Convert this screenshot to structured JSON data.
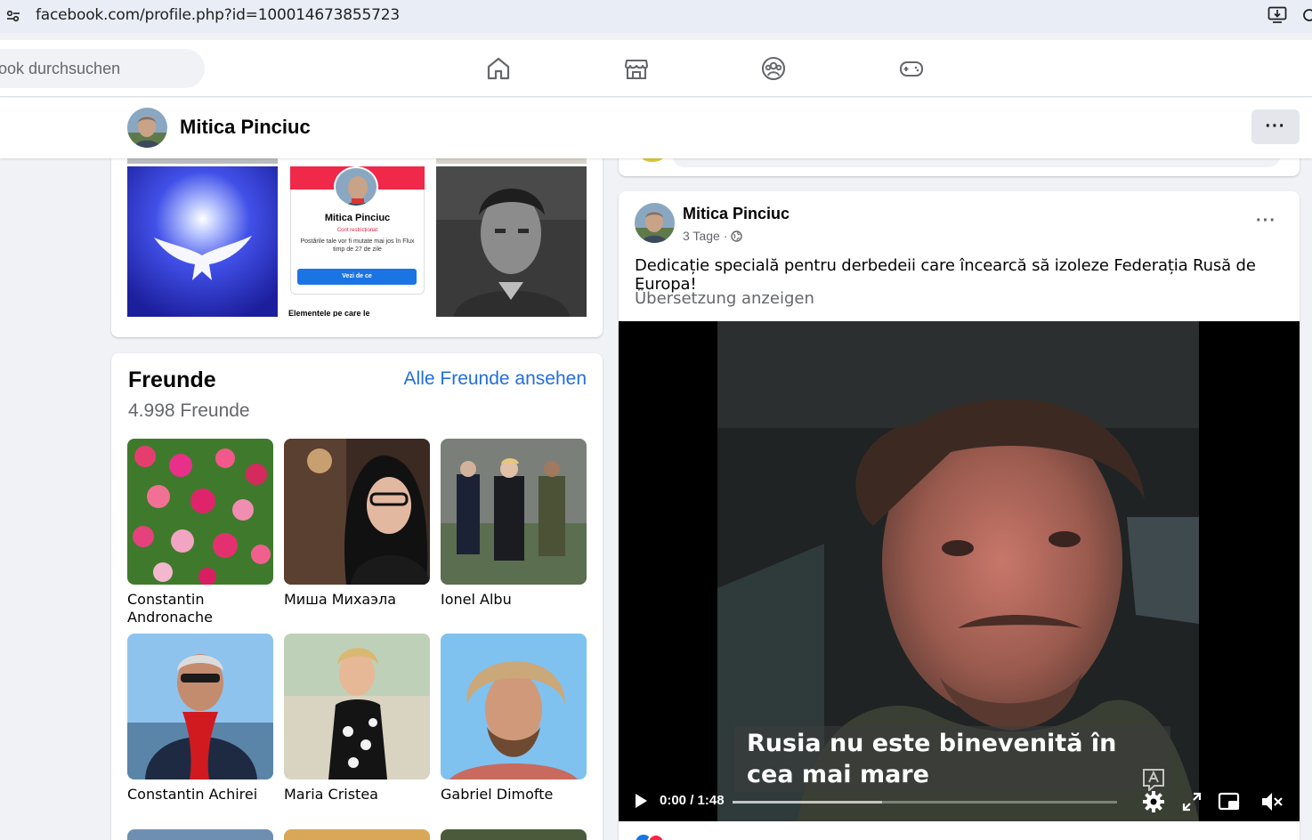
{
  "browser": {
    "url": "facebook.com/profile.php?id=100014673855723"
  },
  "topnav": {
    "search_placeholder": "ook durchsuchen",
    "icons": [
      "home-icon",
      "marketplace-icon",
      "groups-icon",
      "gaming-icon"
    ]
  },
  "profile_bar": {
    "name": "Mitica Pinciuc",
    "more_label": "···"
  },
  "photos": {
    "items": [
      "dove-photo",
      "restricted-account-screenshot",
      "portrait-photo"
    ],
    "screenshot": {
      "name": "Mitica Pinciuc",
      "status": "Cont restricționat",
      "message": "Postările tale vor fi mutate mai jos în Flux timp de 27 de zile",
      "button": "Vezi de ce",
      "footer": "Elementele pe care le"
    }
  },
  "friends": {
    "title": "Freunde",
    "see_all": "Alle Freunde ansehen",
    "count": "4.998 Freunde",
    "list": [
      {
        "name": "Constantin Andronache"
      },
      {
        "name": "Миша Михаэла"
      },
      {
        "name": "Ionel Albu"
      },
      {
        "name": "Constantin Achirei"
      },
      {
        "name": "Maria Cristea"
      },
      {
        "name": "Gabriel Dimofte"
      }
    ]
  },
  "post": {
    "author": "Mitica Pinciuc",
    "time": "3 Tage",
    "separator": "·",
    "text": "Dedicație specială pentru derbedeii care încearcă să izoleze Federația Rusă de Europa!",
    "translate": "Übersetzung anzeigen",
    "more_label": "···",
    "video": {
      "subtitle": "Rusia nu este binevenită în cea mai mare",
      "time": "0:00 / 1:48",
      "progress": 0.39
    }
  }
}
